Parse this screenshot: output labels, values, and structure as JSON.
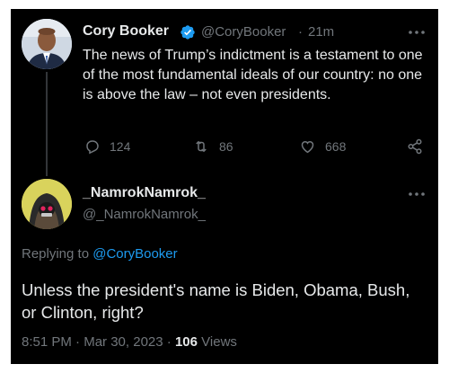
{
  "original_tweet": {
    "display_name": "Cory Booker",
    "handle": "@CoryBooker",
    "separator": "·",
    "time_ago": "21m",
    "text": "The news of Trump’s indictment is a testament to one of the most fundamental ideals of our country: no one is above the law – not even presidents.",
    "replies": "124",
    "retweets": "86",
    "likes": "668"
  },
  "reply_tweet": {
    "display_name": "_NamrokNamrok_",
    "handle": "@_NamrokNamrok_",
    "replying_prefix": "Replying to",
    "replying_to": "@CoryBooker",
    "text": "Unless the president's name is Biden, Obama, Bush, or Clinton, right?",
    "time": "8:51 PM",
    "date": "Mar 30, 2023",
    "dot": "·",
    "views_count": "106",
    "views_label": "Views"
  },
  "colors": {
    "background": "#000000",
    "text_primary": "#e7e9ea",
    "text_muted": "#71767b",
    "accent": "#1d9bf0",
    "verified": "#1d9bf0"
  },
  "icons": [
    "verified-badge-icon",
    "more-options-icon",
    "reply-icon",
    "retweet-icon",
    "like-icon",
    "share-icon"
  ]
}
